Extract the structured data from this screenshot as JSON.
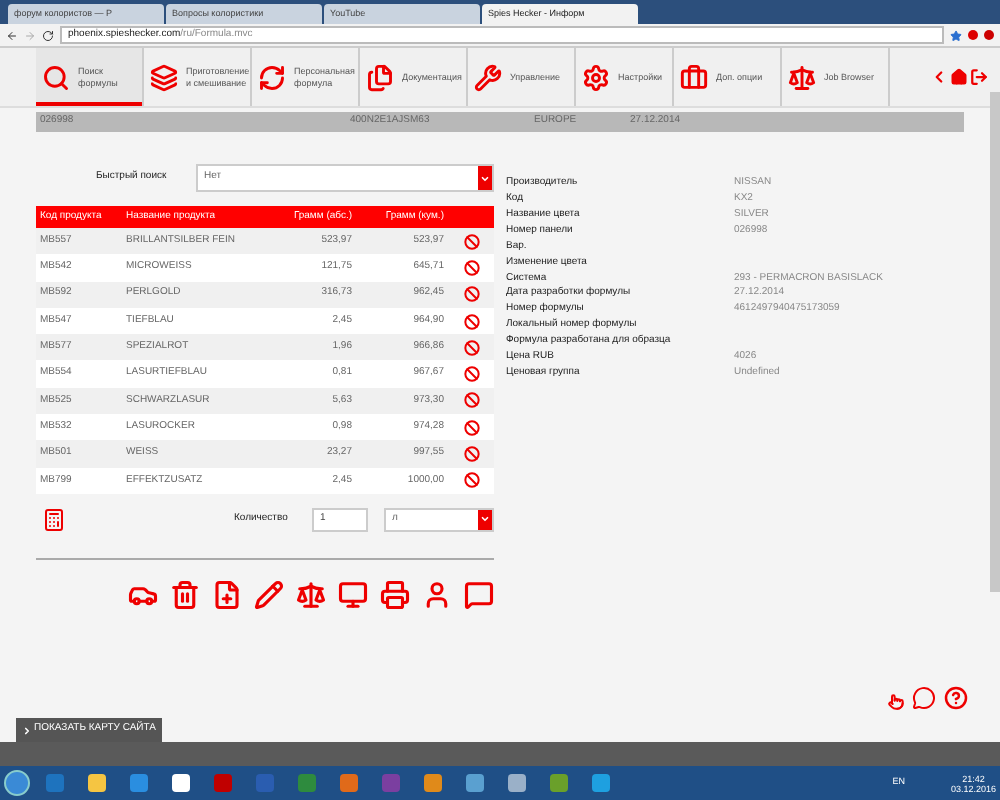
{
  "browser": {
    "tabs": [
      {
        "title": "форум колористов — Р",
        "selected": false
      },
      {
        "title": "Вопросы колористики",
        "selected": false
      },
      {
        "title": "YouTube",
        "selected": false
      },
      {
        "title": "Spies Hecker - Информ",
        "selected": true
      }
    ],
    "url_host": "phoenix.spieshecker.com",
    "url_path": "/ru/Formula.mvc"
  },
  "nav": [
    {
      "label": "Поиск формулы",
      "selected": true
    },
    {
      "label": "Приготовление и смешивание",
      "selected": false
    },
    {
      "label": "Персональная формула",
      "selected": false
    },
    {
      "label": "Документация",
      "selected": false
    },
    {
      "label": "Управление",
      "selected": false
    },
    {
      "label": "Настройки",
      "selected": false
    },
    {
      "label": "Доп. опции",
      "selected": false
    },
    {
      "label": "Job Browser",
      "selected": false
    }
  ],
  "info_bar": [
    "026998",
    "400N2E1AJSM63",
    "EUROPE",
    "27.12.2014"
  ],
  "quick_search": {
    "label": "Быстрый поиск",
    "value": "Нет"
  },
  "table": {
    "columns": [
      "Код продукта",
      "Название продукта",
      "Грамм (абс.)",
      "Грамм (кум.)"
    ],
    "rows": [
      [
        "MB557",
        "BRILLANTSILBER FEIN",
        "523,97",
        "523,97"
      ],
      [
        "MB542",
        "MICROWEISS",
        "121,75",
        "645,71"
      ],
      [
        "MB592",
        "PERLGOLD",
        "316,73",
        "962,45"
      ],
      [
        "MB547",
        "TIEFBLAU",
        "2,45",
        "964,90"
      ],
      [
        "MB577",
        "SPEZIALROT",
        "1,96",
        "966,86"
      ],
      [
        "MB554",
        "LASURTIEFBLAU",
        "0,81",
        "967,67"
      ],
      [
        "MB525",
        "SCHWARZLASUR",
        "5,63",
        "973,30"
      ],
      [
        "MB532",
        "LASUROCKER",
        "0,98",
        "974,28"
      ],
      [
        "MB501",
        "WEISS",
        "23,27",
        "997,55"
      ],
      [
        "MB799",
        "EFFEKTZUSATZ",
        "2,45",
        "1000,00"
      ]
    ]
  },
  "quantity": {
    "label": "Количество",
    "value": "1",
    "unit": "л"
  },
  "details": [
    {
      "label": "Производитель",
      "value": "NISSAN"
    },
    {
      "label": "Код",
      "value": "KX2"
    },
    {
      "label": "Название цвета",
      "value": "SILVER"
    },
    {
      "label": "Номер панели",
      "value": "026998"
    },
    {
      "label": "Вар."
    },
    {
      "label": "Изменение цвета"
    },
    {
      "label": "Система",
      "value": "293 - PERMACRON BASISLACK"
    },
    {
      "label": "Дата разработки формулы",
      "value": "27.12.2014"
    },
    {
      "label": "Номер формулы",
      "value": "4612497940475173059"
    },
    {
      "label": "Локальный номер формулы"
    },
    {
      "label": "Формула разработана для образца"
    },
    {
      "label": "Цена RUB",
      "value": "4026"
    },
    {
      "label": "Ценовая группа",
      "value": "Undefined"
    }
  ],
  "sitemap": "ПОКАЗАТЬ КАРТУ САЙТА",
  "taskbar": {
    "language": "EN",
    "time": "21:42",
    "date": "03.12.2016"
  }
}
